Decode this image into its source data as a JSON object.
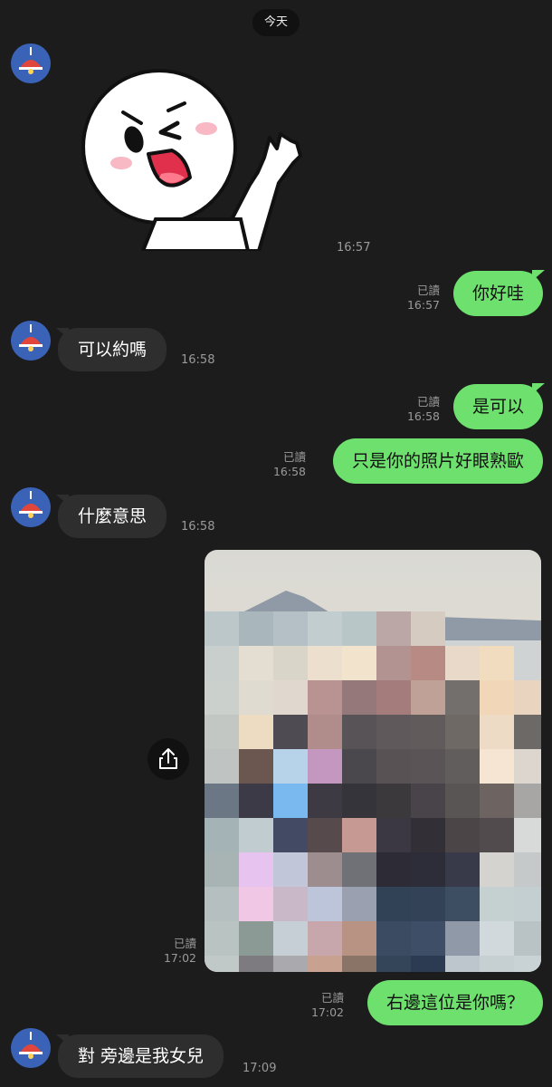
{
  "date_divider": "今天",
  "messages": {
    "m1_time": "16:57",
    "m2": {
      "text": "你好哇",
      "read": "已讀",
      "time": "16:57"
    },
    "m3": {
      "text": "可以約嗎",
      "time": "16:58"
    },
    "m4": {
      "text": "是可以",
      "read": "已讀",
      "time": "16:58"
    },
    "m5": {
      "text": "只是你的照片好眼熟歐",
      "read": "已讀",
      "time": "16:58"
    },
    "m6": {
      "text": "什麼意思",
      "time": "16:58"
    },
    "m7": {
      "read": "已讀",
      "time": "17:02"
    },
    "m8": {
      "text": "右邊這位是你嗎？",
      "read": "已讀",
      "time": "17:02"
    },
    "m9": {
      "text": "對 旁邊是我女兒",
      "time": "17:09"
    }
  },
  "icons": {
    "avatar": "red-lamp-avatar-icon",
    "share": "share-icon",
    "sticker": "waving-character-sticker"
  },
  "colors": {
    "background": "#1c1c1c",
    "outgoing_bubble": "#6ee06e",
    "incoming_bubble": "#2e2e2e",
    "avatar_bg": "#3a63b8",
    "lamp": "#e0463c"
  }
}
